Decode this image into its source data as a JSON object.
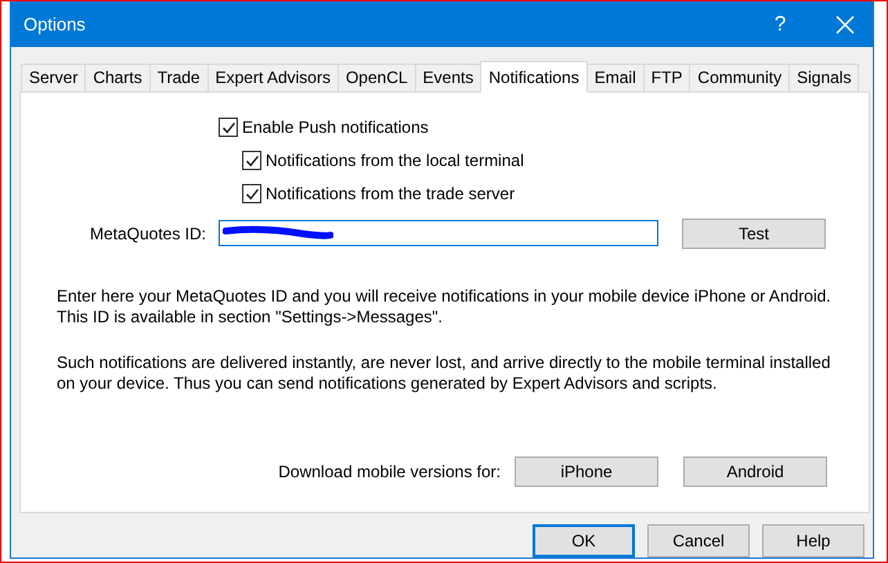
{
  "window": {
    "title": "Options",
    "help": "?"
  },
  "tabs": [
    {
      "label": "Server",
      "selected": false
    },
    {
      "label": "Charts",
      "selected": false
    },
    {
      "label": "Trade",
      "selected": false
    },
    {
      "label": "Expert Advisors",
      "selected": false
    },
    {
      "label": "OpenCL",
      "selected": false
    },
    {
      "label": "Events",
      "selected": false
    },
    {
      "label": "Notifications",
      "selected": true
    },
    {
      "label": "Email",
      "selected": false
    },
    {
      "label": "FTP",
      "selected": false
    },
    {
      "label": "Community",
      "selected": false
    },
    {
      "label": "Signals",
      "selected": false
    }
  ],
  "checkboxes": [
    {
      "label": "Enable Push notifications",
      "checked": true,
      "children": [
        {
          "label": "Notifications from the local terminal",
          "checked": true
        },
        {
          "label": "Notifications from the trade server",
          "checked": true
        }
      ]
    }
  ],
  "id_field": {
    "label": "MetaQuotes ID:",
    "button": "Test"
  },
  "paragraphs": [
    "Enter here your MetaQuotes ID and you will receive notifications in your mobile device iPhone or Android. This ID is available in section \"Settings->Messages\".",
    "Such notifications are delivered instantly, are never lost, and arrive directly to the mobile terminal installed on your device. Thus you can send notifications generated by Expert Advisors and scripts."
  ],
  "download": {
    "label": "Download mobile versions for:",
    "buttons": [
      "iPhone",
      "Android"
    ]
  },
  "buttons": [
    {
      "label": "OK",
      "selected": true
    },
    {
      "label": "Cancel",
      "selected": false
    },
    {
      "label": "Help",
      "selected": false
    }
  ]
}
